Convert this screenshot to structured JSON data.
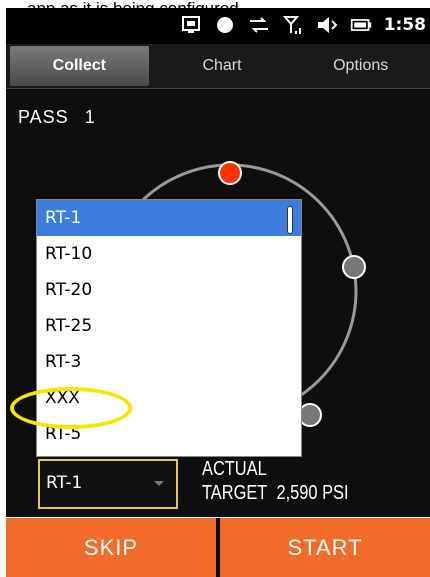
{
  "caption": "…app as it is being configured…",
  "status_bar": {
    "time": "1:58",
    "icons": [
      "screen-sync-icon",
      "record-dot-icon",
      "data-transfer-icon",
      "signal-icon",
      "volume-icon",
      "battery-icon"
    ]
  },
  "tabs": [
    {
      "label": "Collect",
      "active": true
    },
    {
      "label": "Chart",
      "active": false
    },
    {
      "label": "Options",
      "active": false
    }
  ],
  "pass": {
    "label": "PASS",
    "number": "1"
  },
  "dropdown": {
    "items": [
      "RT-1",
      "RT-10",
      "RT-20",
      "RT-25",
      "RT-3",
      "XXX",
      "RT-5"
    ],
    "selected_index": 0,
    "highlighted_item": "XXX"
  },
  "select": {
    "value": "RT-1"
  },
  "readout": {
    "actual_label": "ACTUAL",
    "target_label": "TARGET",
    "target_value": "2,590 PSI"
  },
  "buttons": {
    "skip": "SKIP",
    "start": "START"
  },
  "colors": {
    "accent_orange": "#f36b2a",
    "selection_blue": "#3b7cdc",
    "highlight_yellow": "#f3e600",
    "gauge_red": "#ff3300",
    "gauge_gray": "#9a9a9a",
    "select_border": "#e9c84f"
  }
}
